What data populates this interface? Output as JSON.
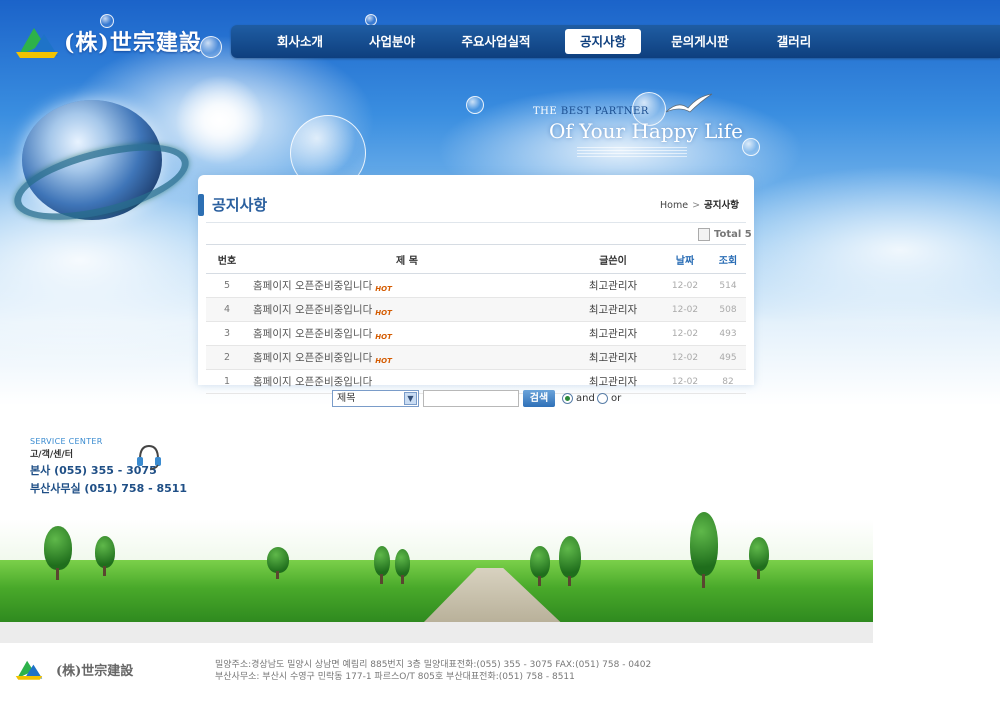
{
  "header": {
    "logo_text": "(株)世宗建設",
    "nav": [
      "회사소개",
      "사업분야",
      "주요사업실적",
      "공지사항",
      "문의게시판",
      "갤러리"
    ],
    "active_nav": "공지사항"
  },
  "slogan": {
    "small_prefix": "THE",
    "small_accent": "BEST PARTNER",
    "big": "Of Your Happy Life"
  },
  "board": {
    "title": "공지사항",
    "breadcrumb": {
      "home": "Home",
      "separator": ">",
      "current": "공지사항"
    },
    "total_label": "Total 5",
    "columns": {
      "no": "번호",
      "subject": "제   목",
      "writer": "글쓴이",
      "date": "날짜",
      "hits": "조회"
    },
    "hot_label": "HOT",
    "rows": [
      {
        "no": "5",
        "subject": "홈페이지 오픈준비중입니다",
        "hot": true,
        "writer": "최고관리자",
        "date": "12-02",
        "hits": "514"
      },
      {
        "no": "4",
        "subject": "홈페이지 오픈준비중입니다",
        "hot": true,
        "writer": "최고관리자",
        "date": "12-02",
        "hits": "508"
      },
      {
        "no": "3",
        "subject": "홈페이지 오픈준비중입니다",
        "hot": true,
        "writer": "최고관리자",
        "date": "12-02",
        "hits": "493"
      },
      {
        "no": "2",
        "subject": "홈페이지 오픈준비중입니다",
        "hot": true,
        "writer": "최고관리자",
        "date": "12-02",
        "hits": "495"
      },
      {
        "no": "1",
        "subject": "홈페이지 오픈준비중입니다",
        "hot": false,
        "writer": "최고관리자",
        "date": "12-02",
        "hits": "82"
      }
    ]
  },
  "search": {
    "field_selected": "제목",
    "query_value": "",
    "button_label": "검색",
    "radio_and": "and",
    "radio_or": "or",
    "selected_mode": "and"
  },
  "service_center": {
    "title": "SERVICE CENTER",
    "subtitle": "고/객/센/터",
    "main_phone": "본사 (055) 355 - 3075",
    "busan_phone": "부산사무실 (051) 758 - 8511"
  },
  "footer": {
    "logo_text": "(株)世宗建設",
    "line1": "밀양주소:경상남도 밀양시 상남면 예림리 885번지 3층 밀양대표전화:(055) 355 - 3075  FAX:(051) 758 - 0402",
    "line2": "부산사무소: 부산시 수영구  민락동  177-1 파르스O/T 805호    부산대표전화:(051) 758 - 8511"
  },
  "colors": {
    "nav_bg": "#0e3f7e",
    "title_blue": "#2a5f9e",
    "hot": "#d45b00",
    "grass": "#49a92a"
  }
}
